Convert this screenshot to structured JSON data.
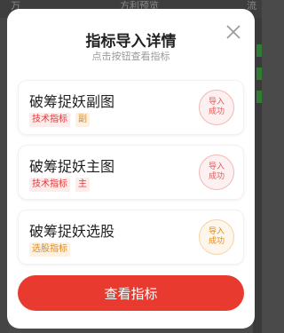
{
  "background": {
    "top_text": [
      "万",
      "方利预览",
      "流"
    ]
  },
  "modal": {
    "title": "指标导入详情",
    "subtitle": "点击按钮查看指标",
    "items": [
      {
        "name": "破筹捉妖副图",
        "tags": [
          "技术指标",
          "副"
        ],
        "status": [
          "导入",
          "成功"
        ]
      },
      {
        "name": "破筹捉妖主图",
        "tags": [
          "技术指标",
          "主"
        ],
        "status": [
          "导入",
          "成功"
        ]
      },
      {
        "name": "破筹捉妖选股",
        "tags": [
          "选股指标"
        ],
        "status": [
          "导入",
          "成功"
        ]
      }
    ],
    "view_button": "查看指标"
  },
  "colors": {
    "accent": "#e93a2f",
    "tag_red": "#e03a3a",
    "tag_orange": "#e08a1e"
  }
}
